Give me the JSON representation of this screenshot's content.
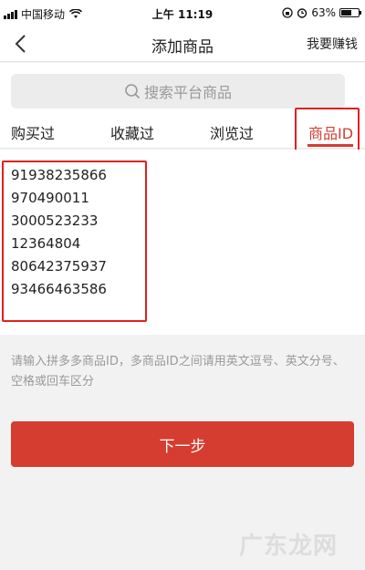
{
  "status_bar": {
    "carrier": "中国移动",
    "time": "上午 11:19",
    "battery_percent": "63%",
    "battery_level": 0.63
  },
  "nav": {
    "title": "添加商品",
    "right_link": "我要赚钱"
  },
  "search": {
    "placeholder": "搜索平台商品"
  },
  "tabs": [
    {
      "label": "购买过"
    },
    {
      "label": "收藏过"
    },
    {
      "label": "浏览过"
    },
    {
      "label": "商品ID",
      "active": true
    }
  ],
  "product_ids": [
    "91938235866",
    "970490011",
    "3000523233",
    "12364804",
    "80642375937",
    "93466463586"
  ],
  "hint": "请输入拼多多商品ID，多商品ID之间请用英文逗号、英文分号、空格或回车区分",
  "next_button": "下一步",
  "watermark": "广东龙网",
  "colors": {
    "accent": "#d43d2f",
    "highlight_box": "#e02020"
  }
}
